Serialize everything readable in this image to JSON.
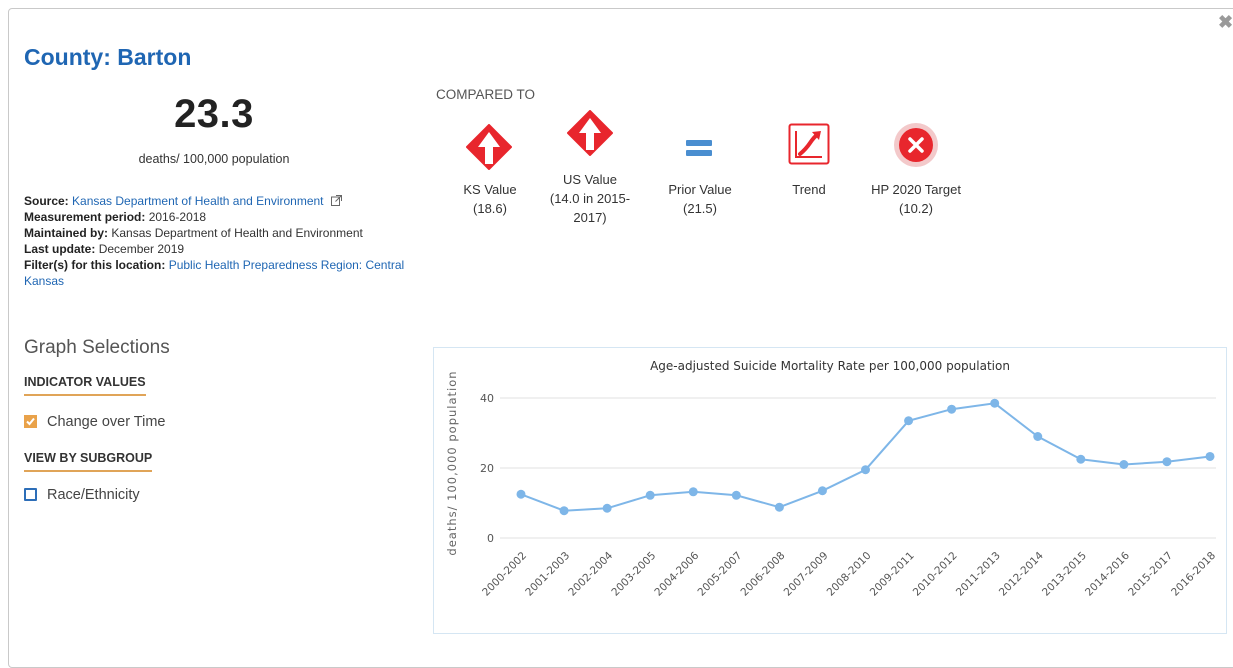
{
  "header": {
    "title": "County: Barton",
    "close_symbol": "✖"
  },
  "value": {
    "main": "23.3",
    "unit": "deaths/ 100,000 population"
  },
  "meta": {
    "source_label": "Source:",
    "source_value": "Kansas Department of Health and Environment",
    "period_label": "Measurement period:",
    "period_value": "2016-2018",
    "maintained_label": "Maintained by:",
    "maintained_value": "Kansas Department of Health and Environment",
    "update_label": "Last update:",
    "update_value": "December 2019",
    "filter_label": "Filter(s) for this location:",
    "filter_value": "Public Health Preparedness Region: Central Kansas"
  },
  "comparisons": {
    "heading": "COMPARED TO",
    "items": [
      {
        "label": "KS Value",
        "detail": "(18.6)",
        "icon": "red-diamond-up-arrow-icon"
      },
      {
        "label": "US Value",
        "detail": "(14.0 in 2015-",
        "detail2": "2017)",
        "icon": "red-diamond-up-arrow-icon"
      },
      {
        "label": "Prior Value",
        "detail": "(21.5)",
        "icon": "equals-icon"
      },
      {
        "label": "Trend",
        "detail": "",
        "icon": "trend-up-icon"
      },
      {
        "label": "HP 2020 Target",
        "detail": "(10.2)",
        "icon": "red-circle-x-icon"
      }
    ]
  },
  "graph_selections": {
    "title": "Graph Selections",
    "indicator_heading": "INDICATOR VALUES",
    "change_over_time": "Change over Time",
    "subgroup_heading": "VIEW BY SUBGROUP",
    "race_ethnicity": "Race/Ethnicity"
  },
  "colors": {
    "accent": "#1f66b3",
    "line": "#7eb6e8",
    "danger": "#e8262d",
    "equals": "#4a8ed0",
    "checkbox": "#e9a24a"
  },
  "chart_data": {
    "type": "line",
    "title": "Age-adjusted Suicide Mortality Rate per 100,000 population",
    "ylabel": "deaths/ 100,000 population",
    "xlabel": "",
    "ylim": [
      0,
      40
    ],
    "yticks": [
      0,
      20,
      40
    ],
    "grid": true,
    "categories": [
      "2000-2002",
      "2001-2003",
      "2002-2004",
      "2003-2005",
      "2004-2006",
      "2005-2007",
      "2006-2008",
      "2007-2009",
      "2008-2010",
      "2009-2011",
      "2010-2012",
      "2011-2013",
      "2012-2014",
      "2013-2015",
      "2014-2016",
      "2015-2017",
      "2016-2018"
    ],
    "values": [
      12.5,
      7.8,
      8.5,
      12.2,
      13.2,
      12.2,
      8.8,
      13.5,
      19.5,
      33.5,
      36.8,
      38.5,
      29.0,
      22.5,
      21.0,
      21.8,
      23.3
    ]
  }
}
